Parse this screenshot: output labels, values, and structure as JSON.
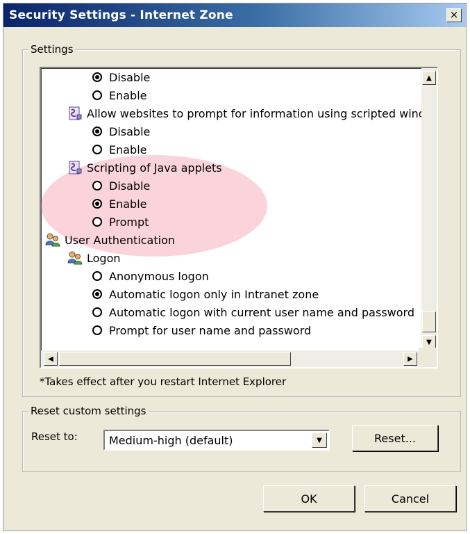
{
  "window": {
    "title": "Security Settings - Internet Zone",
    "close_glyph": "×"
  },
  "settings_group": {
    "label": "Settings"
  },
  "tree_rows": [
    {
      "type": "radio",
      "label": "Disable",
      "checked": true
    },
    {
      "type": "radio",
      "label": "Enable",
      "checked": false
    },
    {
      "type": "category",
      "icon": "script-settings-icon",
      "label": "Allow websites to prompt for information using scripted windo"
    },
    {
      "type": "radio",
      "label": "Disable",
      "checked": true
    },
    {
      "type": "radio",
      "label": "Enable",
      "checked": false
    },
    {
      "type": "category",
      "icon": "script-settings-icon",
      "label": "Scripting of Java applets"
    },
    {
      "type": "radio",
      "label": "Disable",
      "checked": false
    },
    {
      "type": "radio",
      "label": "Enable",
      "checked": true
    },
    {
      "type": "radio",
      "label": "Prompt",
      "checked": false
    },
    {
      "type": "category",
      "icon": "user-authentication-icon",
      "label": "User Authentication"
    },
    {
      "type": "category",
      "icon": "users-logon-icon",
      "label": "Logon"
    },
    {
      "type": "radio",
      "label": "Anonymous logon",
      "checked": false
    },
    {
      "type": "radio",
      "label": "Automatic logon only in Intranet zone",
      "checked": true
    },
    {
      "type": "radio",
      "label": "Automatic logon with current user name and password",
      "checked": false
    },
    {
      "type": "radio",
      "label": "Prompt for user name and password",
      "checked": false
    }
  ],
  "footnote": "*Takes effect after you restart Internet Explorer",
  "reset_group": {
    "label": "Reset custom settings",
    "reset_to_label": "Reset to:",
    "selected_level": "Medium-high (default)",
    "reset_button": "Reset..."
  },
  "buttons": {
    "ok": "OK",
    "cancel": "Cancel"
  },
  "highlight_color": "#ee788c"
}
